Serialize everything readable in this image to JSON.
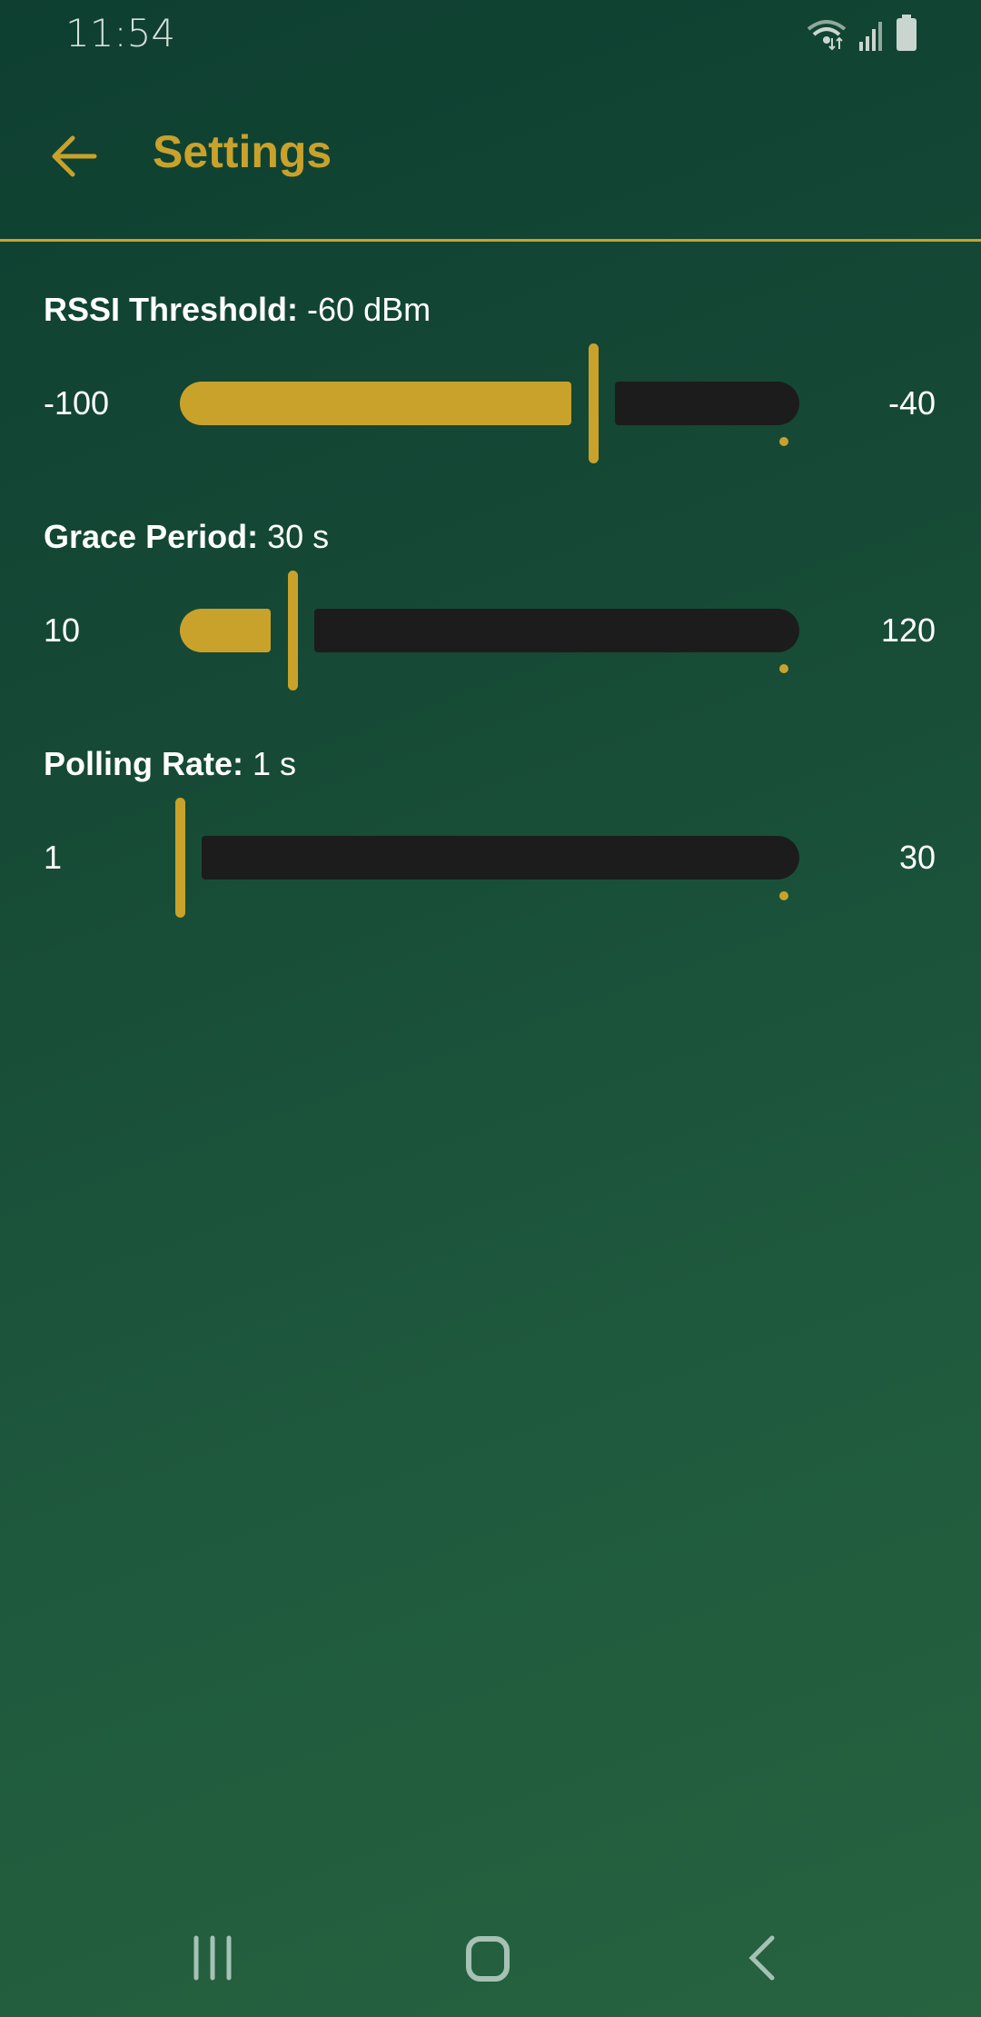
{
  "status_bar": {
    "time": "11:54",
    "icons": [
      "wifi-icon",
      "signal-icon",
      "battery-icon"
    ]
  },
  "app_bar": {
    "title": "Settings",
    "back_icon": "arrow-left-icon"
  },
  "colors": {
    "accent": "#c9a22b",
    "track_inactive": "#1c1c1c",
    "background_top": "#0e3f31",
    "background_bottom": "#27633f"
  },
  "settings": [
    {
      "name": "RSSI Threshold:",
      "value_text": "-60 dBm",
      "min_label": "-100",
      "max_label": "-40",
      "min": -100,
      "max": -40,
      "value": -60
    },
    {
      "name": "Grace Period:",
      "value_text": "30 s",
      "min_label": "10",
      "max_label": "120",
      "min": 10,
      "max": 120,
      "value": 30
    },
    {
      "name": "Polling Rate:",
      "value_text": "1 s",
      "min_label": "1",
      "max_label": "30",
      "min": 1,
      "max": 30,
      "value": 1
    }
  ],
  "nav_bar": {
    "icons": [
      "recents-icon",
      "home-icon",
      "back-icon"
    ]
  }
}
